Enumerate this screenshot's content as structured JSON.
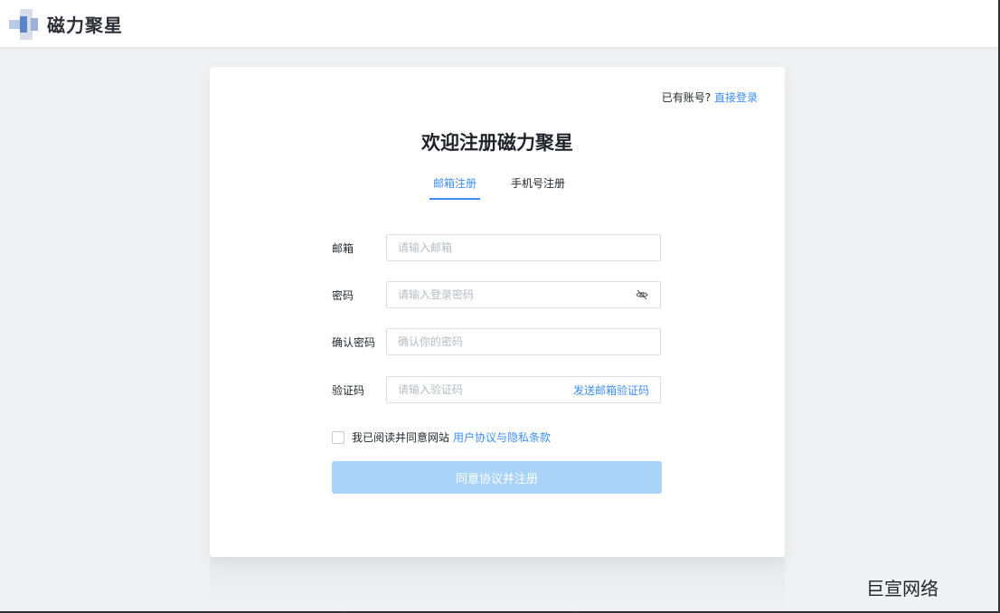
{
  "header": {
    "brand": "磁力聚星",
    "logo_icon": "brand-logo-icon"
  },
  "card": {
    "login_hint_prefix": "已有账号?",
    "login_link": "直接登录",
    "title": "欢迎注册磁力聚星",
    "tabs": [
      {
        "label": "邮箱注册",
        "active": true
      },
      {
        "label": "手机号注册",
        "active": false
      }
    ],
    "form": {
      "email": {
        "label": "邮箱",
        "placeholder": "请输入邮箱",
        "value": ""
      },
      "password": {
        "label": "密码",
        "placeholder": "请输入登录密码",
        "value": "",
        "toggle_icon": "eye-off-icon"
      },
      "confirm": {
        "label": "确认密码",
        "placeholder": "确认你的密码",
        "value": ""
      },
      "code": {
        "label": "验证码",
        "placeholder": "请输入验证码",
        "value": "",
        "send_label": "发送邮箱验证码"
      }
    },
    "agreement": {
      "checked": false,
      "text": "我已阅读并同意网站",
      "link": "用户协议与隐私条款"
    },
    "submit_label": "同意协议并注册"
  },
  "watermark": "巨宣网络",
  "colors": {
    "accent": "#3e8ef7",
    "submit_disabled": "#a9d3f8",
    "background": "#f0f1f3"
  }
}
